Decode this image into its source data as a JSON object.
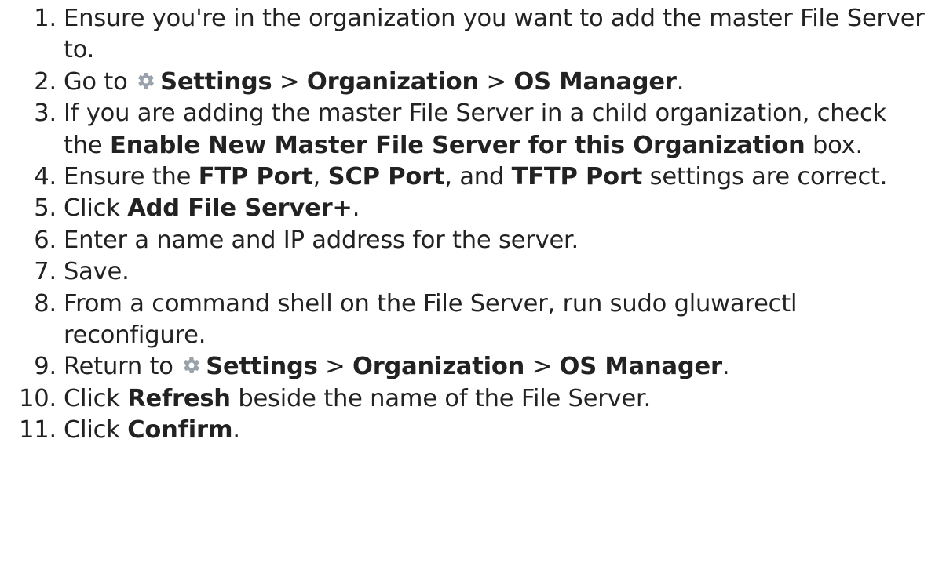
{
  "icons": {
    "settings": "gear-icon"
  },
  "colors": {
    "text": "#222222",
    "gear": "#9aa3ab"
  },
  "steps": [
    {
      "number": "1.",
      "text": "Ensure you're in the organization you want to add the master File Server to."
    },
    {
      "number": "2.",
      "go_to": "Go to",
      "settings": "Settings",
      "sep1": ">",
      "organization": "Organization",
      "sep2": ">",
      "os_manager": "OS Manager",
      "end": "."
    },
    {
      "number": "3.",
      "pre": "If you are adding the master File Server in a child organization, check the",
      "checkbox_label": "Enable New Master File Server for this Organization",
      "post": "box."
    },
    {
      "number": "4.",
      "pre": "Ensure the",
      "ftp_port": "FTP Port",
      "comma1": ",",
      "scp_port": "SCP Port",
      "and": ", and",
      "tftp_port": "TFTP Port",
      "post": "settings are correct."
    },
    {
      "number": "5.",
      "pre": "Click",
      "button": "Add File Server+",
      "end": "."
    },
    {
      "number": "6.",
      "text": "Enter a name and IP address for the server."
    },
    {
      "number": "7.",
      "text": "Save."
    },
    {
      "number": "8.",
      "text": "From a command shell on the File Server, run sudo gluwarectl reconfigure."
    },
    {
      "number": "9.",
      "return_to": "Return to",
      "settings": "Settings",
      "sep1": ">",
      "organization": "Organization",
      "sep2": ">",
      "os_manager": "OS Manager",
      "end": "."
    },
    {
      "number": "10.",
      "pre": "Click",
      "button": "Refresh",
      "post": "beside the name of the File Server."
    },
    {
      "number": "11.",
      "pre": "Click",
      "button": "Confirm",
      "end": "."
    }
  ]
}
